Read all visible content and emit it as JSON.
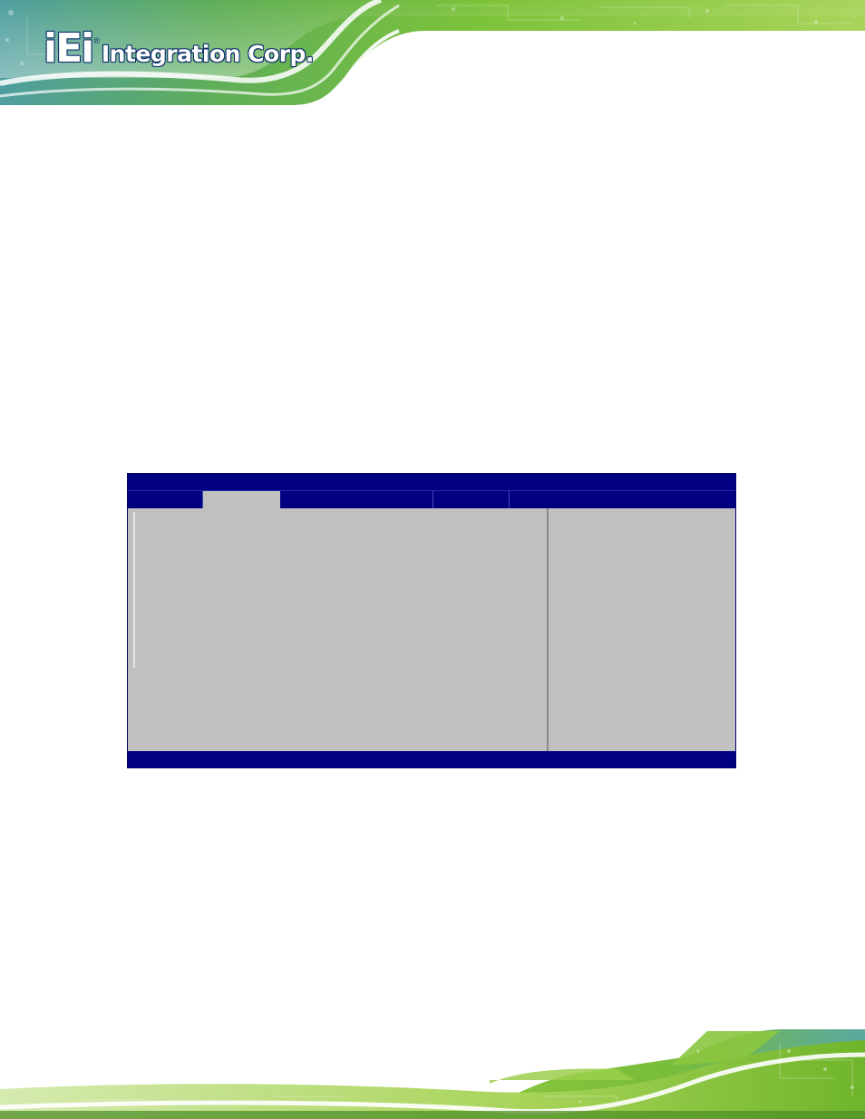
{
  "logo": {
    "mark": "iEi",
    "registered": "®",
    "name": "Integration Corp."
  },
  "colors": {
    "banner_green": "#6fb52b",
    "banner_green_light": "#b9dc6a",
    "banner_teal": "#5aa8a0",
    "bios_blue": "#000080",
    "bios_gray": "#c0c0c0"
  },
  "bios": {
    "active_tab_index": 1,
    "tab_count": 5
  }
}
